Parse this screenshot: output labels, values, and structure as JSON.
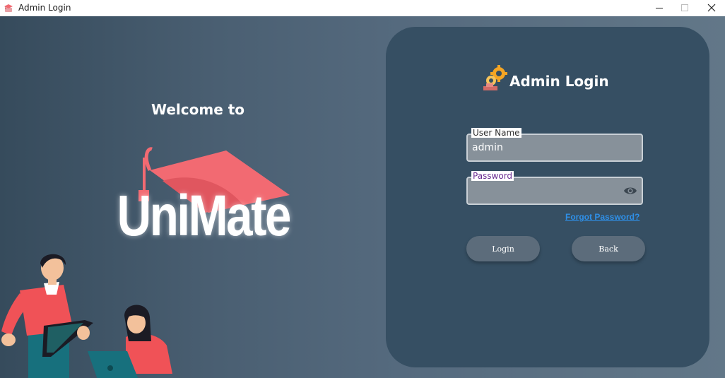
{
  "window": {
    "title": "Admin Login",
    "app_icon": "graduation-cap-icon",
    "controls": [
      "minimize-icon",
      "maximize-icon",
      "close-icon"
    ]
  },
  "hero": {
    "welcome_text": "Welcome to",
    "brand_name": "UniMate",
    "brand_icon": "graduation-cap-icon",
    "illustration": "students-with-tablet-and-laptop"
  },
  "card": {
    "title": "Admin Login",
    "title_icon": "gears-icon",
    "username": {
      "label": "User Name",
      "value": "admin"
    },
    "password": {
      "label": "Password",
      "value": "",
      "toggle_icon": "eye-icon"
    },
    "forgot_password": "Forgot Password?",
    "login_button": "Login",
    "back_button": "Back"
  },
  "colors": {
    "card_bg": "#364f63",
    "accent_coral": "#f26a72",
    "link_blue": "#2f8fe6",
    "button_bg": "#5c6c7b",
    "icon_orange": "#f5a524"
  }
}
